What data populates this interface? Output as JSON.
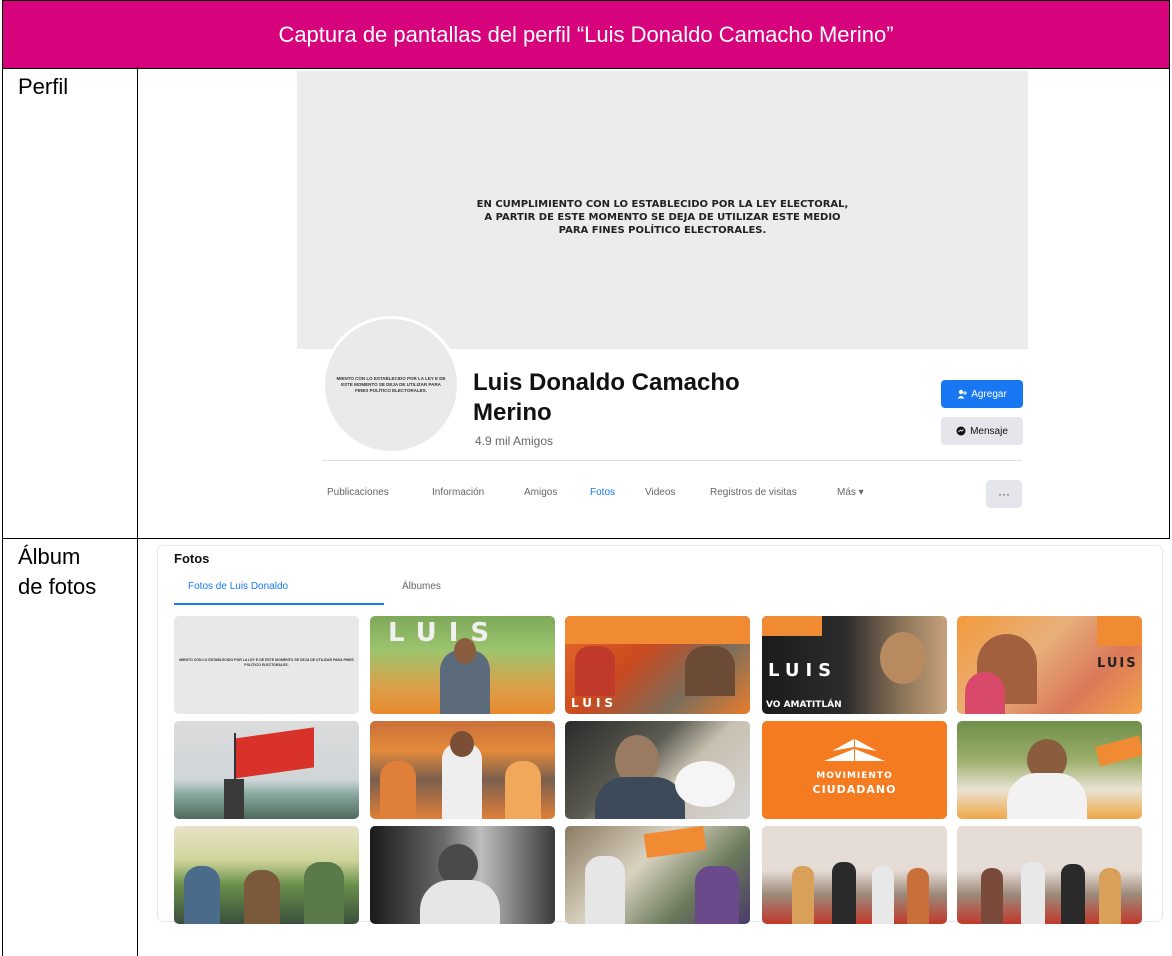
{
  "header": {
    "title": "Captura de pantallas del perfil “Luis Donaldo Camacho Merino”"
  },
  "labels": {
    "profile": "Perfil",
    "album_line1": "Álbum",
    "album_line2": "de fotos"
  },
  "profile": {
    "cover_text_1": "EN CUMPLIMIENTO CON LO ESTABLECIDO POR LA LEY ELECTORAL,",
    "cover_text_2": "A PARTIR DE ESTE MOMENTO SE DEJA DE UTILIZAR ESTE MEDIO",
    "cover_text_3": "PARA FINES POLÍTICO ELECTORALES.",
    "avatar_text": "MIENTO CON LO ESTABLECIDO POR LA LEY E DE ESTE MOMENTO SE DEJA DE UTILIZAR PARA FINES POLÍTICO ELECTORALES.",
    "name_line1": "Luis Donaldo Camacho",
    "name_line2": "Merino",
    "friends": "4.9 mil Amigos",
    "add_label": "Agregar",
    "message_label": "Mensaje",
    "more_label": "···",
    "tabs": [
      "Publicaciones",
      "Información",
      "Amigos",
      "Fotos",
      "Videos",
      "Registros de visitas",
      "Más ▾"
    ],
    "active_tab": "Fotos"
  },
  "photos": {
    "title": "Fotos",
    "tab_photos_of": "Fotos de Luis Donaldo",
    "tab_albums": "Álbumes",
    "thumb_text": "MIENTO CON LO ESTABLECIDO POR LA LEY E DE ESTE MOMENTO SE DEJA DE UTILIZAR PARA FINES POLÍTICO ELECTORALES.",
    "overlay_luis": "LUIS",
    "overlay_movimiento": "MOVIMIENTO",
    "overlay_ciudadano": "CIUDADANO",
    "overlay_amatitlan": "VO AMATITLÁN"
  },
  "colors": {
    "header": "#d6037c",
    "accent": "#1877f2",
    "orange": "#f47b20"
  }
}
